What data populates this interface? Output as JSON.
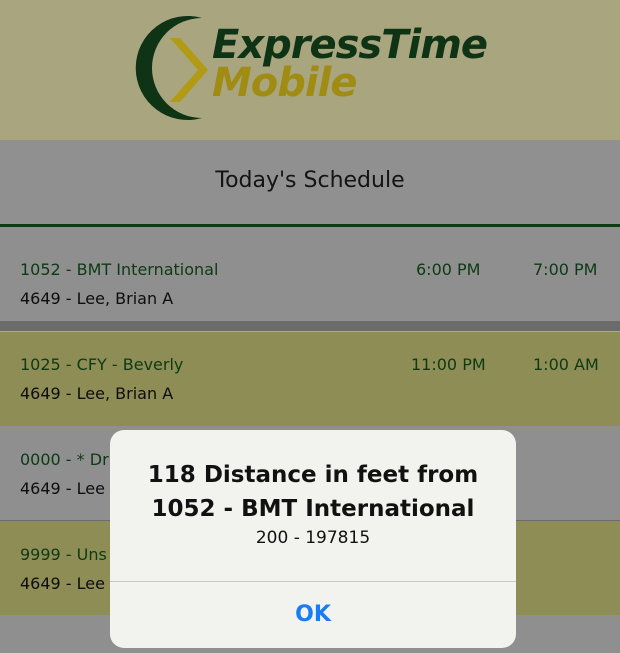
{
  "header": {
    "logo_line1": "ExpressTime",
    "logo_line2": "Mobile"
  },
  "title": "Today's Schedule",
  "rows": [
    {
      "line1": "1052 - BMT International",
      "line2": "4649 - Lee, Brian A",
      "start": "6:00 PM",
      "end": "7:00 PM"
    },
    {
      "line1": "1025 - CFY - Beverly",
      "line2": "4649 - Lee, Brian A",
      "start": "11:00 PM",
      "end": "1:00 AM"
    },
    {
      "line1": "0000 - * Dr",
      "line2": "4649 - Lee",
      "start": "",
      "end": ""
    },
    {
      "line1": "9999 - Uns",
      "line2": "4649 - Lee",
      "start": "",
      "end": ""
    }
  ],
  "dialog": {
    "title_line1": "118 Distance in feet from",
    "title_line2": "1052 - BMT International",
    "message": "200 - 197815",
    "ok_label": "OK"
  },
  "colors": {
    "brand_dark_green": "#0f3315",
    "brand_gold": "#a08c12",
    "link_blue": "#1a7cf5"
  }
}
